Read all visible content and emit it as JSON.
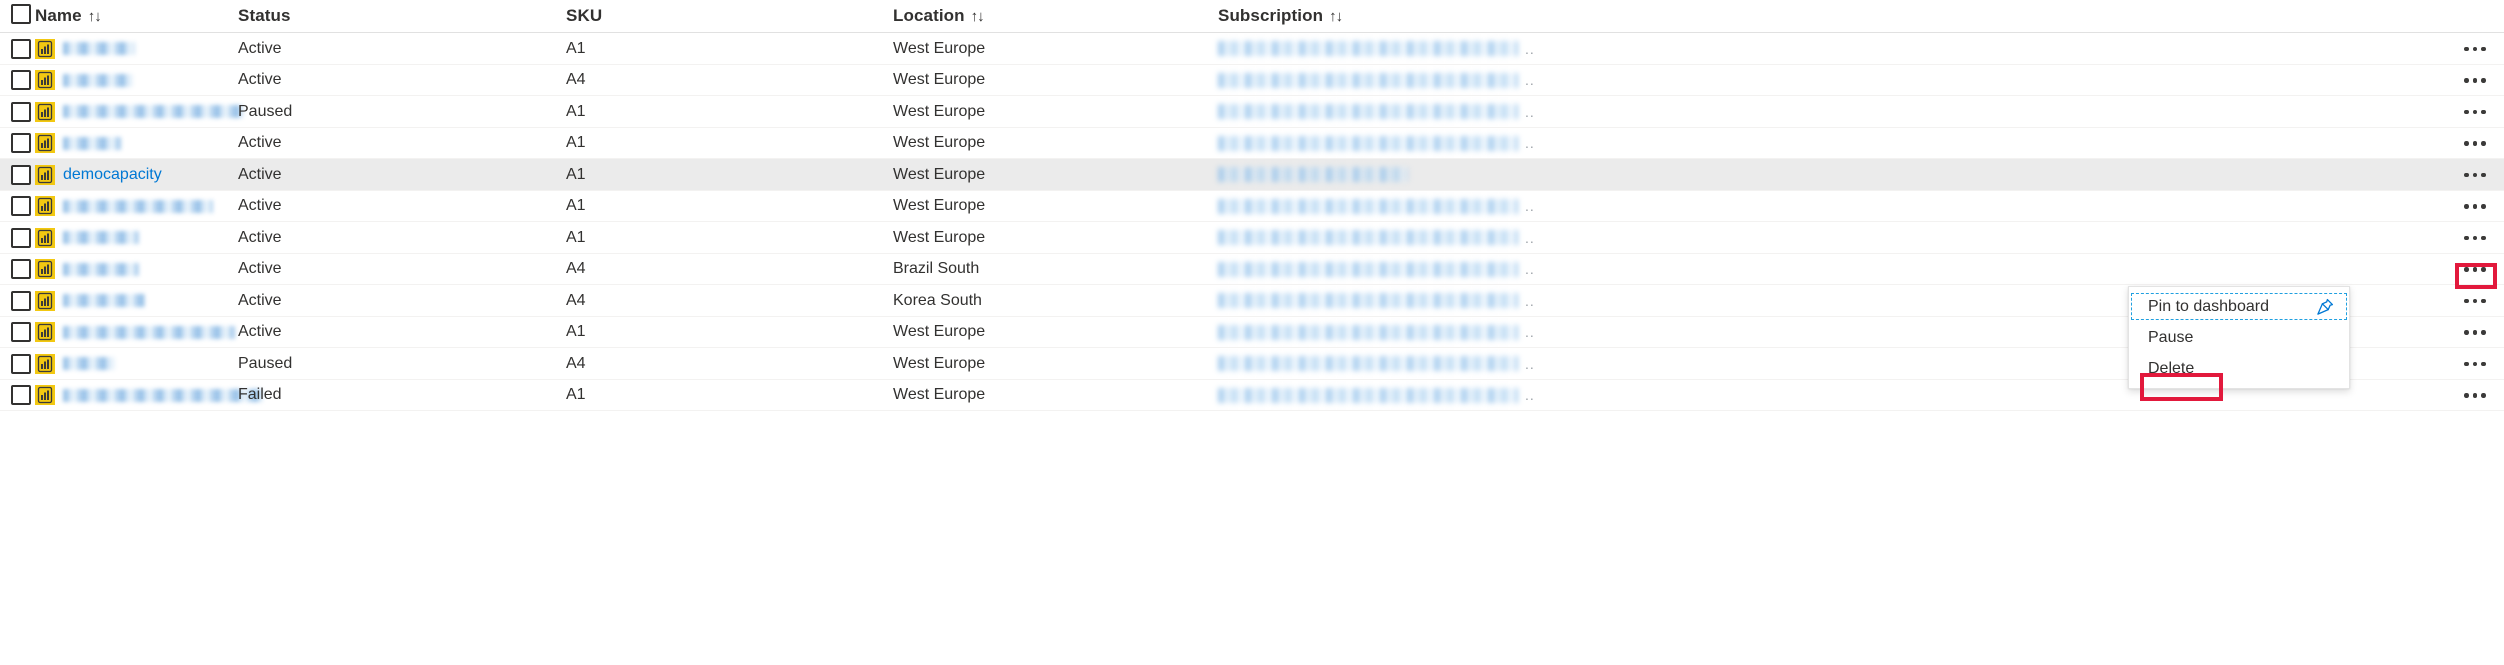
{
  "table": {
    "columns": [
      {
        "key": "name",
        "label": "Name",
        "sortable": true,
        "sort_icon": "↑↓"
      },
      {
        "key": "status",
        "label": "Status",
        "sortable": false,
        "sort_icon": ""
      },
      {
        "key": "sku",
        "label": "SKU",
        "sortable": false,
        "sort_icon": ""
      },
      {
        "key": "location",
        "label": "Location",
        "sortable": true,
        "sort_icon": "↑↓"
      },
      {
        "key": "subscription",
        "label": "Subscription",
        "sortable": true,
        "sort_icon": "↑↓"
      }
    ],
    "select_all_checkbox": {
      "checked": false
    },
    "rows": [
      {
        "name": "",
        "name_blurred": true,
        "name_width": 72,
        "status": "Active",
        "sku": "A1",
        "location": "West Europe",
        "subscription_blurred": true,
        "subscription_truncation": "..",
        "selected": false
      },
      {
        "name": "",
        "name_blurred": true,
        "name_width": 70,
        "status": "Active",
        "sku": "A4",
        "location": "West Europe",
        "subscription_blurred": true,
        "subscription_truncation": "..",
        "selected": false
      },
      {
        "name": "",
        "name_blurred": true,
        "name_width": 180,
        "status": "Paused",
        "sku": "A1",
        "location": "West Europe",
        "subscription_blurred": true,
        "subscription_truncation": "..",
        "selected": false
      },
      {
        "name": "",
        "name_blurred": true,
        "name_width": 58,
        "status": "Active",
        "sku": "A1",
        "location": "West Europe",
        "subscription_blurred": true,
        "subscription_truncation": "..",
        "selected": false
      },
      {
        "name": "democapacity",
        "name_blurred": false,
        "name_width": 0,
        "status": "Active",
        "sku": "A1",
        "location": "West Europe",
        "subscription_blurred": true,
        "subscription_truncation": "",
        "selected": true
      },
      {
        "name": "",
        "name_blurred": true,
        "name_width": 150,
        "status": "Active",
        "sku": "A1",
        "location": "West Europe",
        "subscription_blurred": true,
        "subscription_truncation": "..",
        "selected": false
      },
      {
        "name": "",
        "name_blurred": true,
        "name_width": 76,
        "status": "Active",
        "sku": "A1",
        "location": "West Europe",
        "subscription_blurred": true,
        "subscription_truncation": "..",
        "selected": false
      },
      {
        "name": "",
        "name_blurred": true,
        "name_width": 76,
        "status": "Active",
        "sku": "A4",
        "location": "Brazil South",
        "subscription_blurred": true,
        "subscription_truncation": "..",
        "selected": false
      },
      {
        "name": "",
        "name_blurred": true,
        "name_width": 82,
        "status": "Active",
        "sku": "A4",
        "location": "Korea South",
        "subscription_blurred": true,
        "subscription_truncation": "..",
        "selected": false
      },
      {
        "name": "",
        "name_blurred": true,
        "name_width": 172,
        "status": "Active",
        "sku": "A1",
        "location": "West Europe",
        "subscription_blurred": true,
        "subscription_truncation": "..",
        "selected": false
      },
      {
        "name": "",
        "name_blurred": true,
        "name_width": 52,
        "status": "Paused",
        "sku": "A4",
        "location": "West Europe",
        "subscription_blurred": true,
        "subscription_truncation": "..",
        "selected": false
      },
      {
        "name": "",
        "name_blurred": true,
        "name_width": 200,
        "status": "Failed",
        "sku": "A1",
        "location": "West Europe",
        "subscription_blurred": true,
        "subscription_truncation": "..",
        "selected": false
      }
    ],
    "row_icon": "power-bi-capacity-icon",
    "row_action_icon": "more-actions-ellipsis-icon"
  },
  "context_menu": {
    "items": [
      {
        "label": "Pin to dashboard",
        "icon": "pin-icon",
        "focused": true,
        "annotated": false
      },
      {
        "label": "Pause",
        "icon": "",
        "focused": false,
        "annotated": false
      },
      {
        "label": "Delete",
        "icon": "",
        "focused": false,
        "annotated": true
      }
    ]
  },
  "annotations": {
    "ellipsis_highlight": {
      "color": "#E2193C",
      "target": "more-actions-ellipsis-icon"
    },
    "delete_highlight": {
      "color": "#E2193C",
      "target": "menu-item-delete"
    }
  },
  "colors": {
    "accent_link": "#0078d4",
    "powerbi_yellow": "#F2C811",
    "annotation_red": "#E2193C",
    "selected_row": "#EBEBEB",
    "focus_dashed": "#20A0E0"
  }
}
